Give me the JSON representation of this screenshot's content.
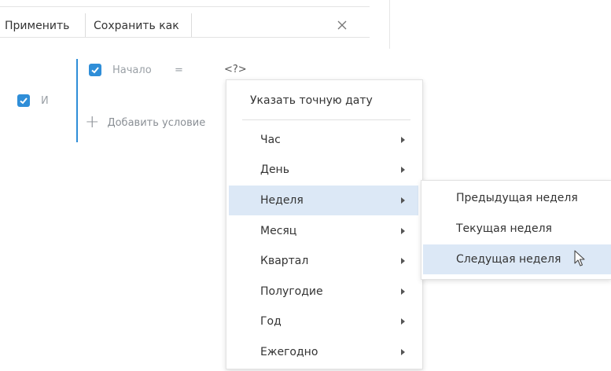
{
  "toolbar": {
    "apply_label": "Применить",
    "save_as_label": "Сохранить как",
    "close_icon": "close-icon"
  },
  "filter": {
    "group_operator": "И",
    "group_checked": true,
    "condition": {
      "checked": true,
      "field": "Начало",
      "operator": "=",
      "value": "<?>"
    },
    "add_condition_label": "Добавить условие"
  },
  "context_menu": {
    "exact_date_label": "Указать точную дату",
    "items": [
      {
        "label": "Час",
        "has_submenu": true
      },
      {
        "label": "День",
        "has_submenu": true
      },
      {
        "label": "Неделя",
        "has_submenu": true,
        "active": true
      },
      {
        "label": "Месяц",
        "has_submenu": true
      },
      {
        "label": "Квартал",
        "has_submenu": true
      },
      {
        "label": "Полугодие",
        "has_submenu": true
      },
      {
        "label": "Год",
        "has_submenu": true
      },
      {
        "label": "Ежегодно",
        "has_submenu": true
      }
    ]
  },
  "submenu": {
    "items": [
      {
        "label": "Предыдущая неделя"
      },
      {
        "label": "Текущая неделя"
      },
      {
        "label": "Следущая неделя",
        "active": true
      }
    ]
  },
  "colors": {
    "accent": "#2f8ed8",
    "highlight": "#dce8f6",
    "muted_text": "#9aa0a6"
  }
}
